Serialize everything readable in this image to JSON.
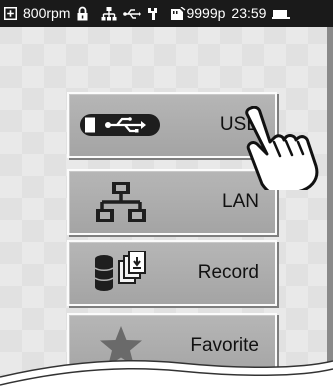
{
  "status_bar": {
    "speed": "800rpm",
    "count": "9999p",
    "time": "23:59",
    "icons": [
      "plus-box-icon",
      "lock-icon",
      "network-icon",
      "usb-icon",
      "tool-icon",
      "memory-card-icon",
      "battery-icon"
    ]
  },
  "menu": {
    "buttons": [
      {
        "label": "USB",
        "icon": "usb-icon"
      },
      {
        "label": "LAN",
        "icon": "lan-icon"
      },
      {
        "label": "Record",
        "icon": "record-icon"
      },
      {
        "label": "Favorite",
        "icon": "star-icon"
      }
    ]
  },
  "colors": {
    "status_bar": "#1a1a1a",
    "screen": "#e9e9e9",
    "button": "#aeaeae",
    "icon": "#1e1e1e",
    "star": "#6a6a6a"
  },
  "pointer_icon": "pointing-hand-icon"
}
